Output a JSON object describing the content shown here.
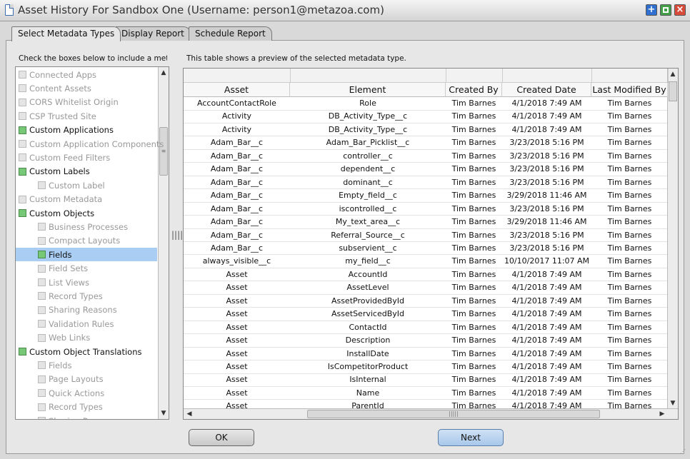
{
  "window": {
    "title": "Asset History For Sandbox One (Username: person1@metazoa.com)"
  },
  "tabs": [
    {
      "label": "Select Metadata Types",
      "active": true
    },
    {
      "label": "Display Report",
      "active": false
    },
    {
      "label": "Schedule Report",
      "active": false
    }
  ],
  "left_panel": {
    "instruction": "Check the boxes below to include a met",
    "items": [
      {
        "label": "Connected Apps",
        "indent": 0,
        "checked": false,
        "enabled": false,
        "selected": false
      },
      {
        "label": "Content Assets",
        "indent": 0,
        "checked": false,
        "enabled": false,
        "selected": false
      },
      {
        "label": "CORS Whitelist Origin",
        "indent": 0,
        "checked": false,
        "enabled": false,
        "selected": false
      },
      {
        "label": "CSP Trusted Site",
        "indent": 0,
        "checked": false,
        "enabled": false,
        "selected": false
      },
      {
        "label": "Custom Applications",
        "indent": 0,
        "checked": true,
        "enabled": true,
        "selected": false
      },
      {
        "label": "Custom Application Components",
        "indent": 0,
        "checked": false,
        "enabled": false,
        "selected": false
      },
      {
        "label": "Custom Feed Filters",
        "indent": 0,
        "checked": false,
        "enabled": false,
        "selected": false
      },
      {
        "label": "Custom Labels",
        "indent": 0,
        "checked": true,
        "enabled": true,
        "selected": false
      },
      {
        "label": "Custom Label",
        "indent": 1,
        "checked": false,
        "enabled": false,
        "selected": false
      },
      {
        "label": "Custom Metadata",
        "indent": 0,
        "checked": false,
        "enabled": false,
        "selected": false
      },
      {
        "label": "Custom Objects",
        "indent": 0,
        "checked": true,
        "enabled": true,
        "selected": false
      },
      {
        "label": "Business Processes",
        "indent": 1,
        "checked": false,
        "enabled": false,
        "selected": false
      },
      {
        "label": "Compact Layouts",
        "indent": 1,
        "checked": false,
        "enabled": false,
        "selected": false
      },
      {
        "label": "Fields",
        "indent": 1,
        "checked": true,
        "enabled": true,
        "selected": true
      },
      {
        "label": "Field Sets",
        "indent": 1,
        "checked": false,
        "enabled": false,
        "selected": false
      },
      {
        "label": "List Views",
        "indent": 1,
        "checked": false,
        "enabled": false,
        "selected": false
      },
      {
        "label": "Record Types",
        "indent": 1,
        "checked": false,
        "enabled": false,
        "selected": false
      },
      {
        "label": "Sharing Reasons",
        "indent": 1,
        "checked": false,
        "enabled": false,
        "selected": false
      },
      {
        "label": "Validation Rules",
        "indent": 1,
        "checked": false,
        "enabled": false,
        "selected": false
      },
      {
        "label": "Web Links",
        "indent": 1,
        "checked": false,
        "enabled": false,
        "selected": false
      },
      {
        "label": "Custom Object Translations",
        "indent": 0,
        "checked": true,
        "enabled": true,
        "selected": false
      },
      {
        "label": "Fields",
        "indent": 1,
        "checked": false,
        "enabled": false,
        "selected": false
      },
      {
        "label": "Page Layouts",
        "indent": 1,
        "checked": false,
        "enabled": false,
        "selected": false
      },
      {
        "label": "Quick Actions",
        "indent": 1,
        "checked": false,
        "enabled": false,
        "selected": false
      },
      {
        "label": "Record Types",
        "indent": 1,
        "checked": false,
        "enabled": false,
        "selected": false
      },
      {
        "label": "Sharing Reasons",
        "indent": 1,
        "checked": false,
        "enabled": false,
        "selected": false
      }
    ]
  },
  "right_panel": {
    "description": "This table shows a preview of the selected metadata type.",
    "columns": [
      "Asset",
      "Element",
      "Created By",
      "Created Date",
      "Last Modified By"
    ],
    "rows": [
      [
        "AccountContactRole",
        "Role",
        "Tim Barnes",
        "4/1/2018 7:49 AM",
        "Tim Barnes"
      ],
      [
        "Activity",
        "DB_Activity_Type__c",
        "Tim Barnes",
        "4/1/2018 7:49 AM",
        "Tim Barnes"
      ],
      [
        "Activity",
        "DB_Activity_Type__c",
        "Tim Barnes",
        "4/1/2018 7:49 AM",
        "Tim Barnes"
      ],
      [
        "Adam_Bar__c",
        "Adam_Bar_Picklist__c",
        "Tim Barnes",
        "3/23/2018 5:16 PM",
        "Tim Barnes"
      ],
      [
        "Adam_Bar__c",
        "controller__c",
        "Tim Barnes",
        "3/23/2018 5:16 PM",
        "Tim Barnes"
      ],
      [
        "Adam_Bar__c",
        "dependent__c",
        "Tim Barnes",
        "3/23/2018 5:16 PM",
        "Tim Barnes"
      ],
      [
        "Adam_Bar__c",
        "dominant__c",
        "Tim Barnes",
        "3/23/2018 5:16 PM",
        "Tim Barnes"
      ],
      [
        "Adam_Bar__c",
        "Empty_field__c",
        "Tim Barnes",
        "3/29/2018 11:46 AM",
        "Tim Barnes"
      ],
      [
        "Adam_Bar__c",
        "iscontrolled__c",
        "Tim Barnes",
        "3/23/2018 5:16 PM",
        "Tim Barnes"
      ],
      [
        "Adam_Bar__c",
        "My_text_area__c",
        "Tim Barnes",
        "3/29/2018 11:46 AM",
        "Tim Barnes"
      ],
      [
        "Adam_Bar__c",
        "Referral_Source__c",
        "Tim Barnes",
        "3/23/2018 5:16 PM",
        "Tim Barnes"
      ],
      [
        "Adam_Bar__c",
        "subservient__c",
        "Tim Barnes",
        "3/23/2018 5:16 PM",
        "Tim Barnes"
      ],
      [
        "always_visible__c",
        "my_field__c",
        "Tim Barnes",
        "10/10/2017 11:07 AM",
        "Tim Barnes"
      ],
      [
        "Asset",
        "AccountId",
        "Tim Barnes",
        "4/1/2018 7:49 AM",
        "Tim Barnes"
      ],
      [
        "Asset",
        "AssetLevel",
        "Tim Barnes",
        "4/1/2018 7:49 AM",
        "Tim Barnes"
      ],
      [
        "Asset",
        "AssetProvidedById",
        "Tim Barnes",
        "4/1/2018 7:49 AM",
        "Tim Barnes"
      ],
      [
        "Asset",
        "AssetServicedById",
        "Tim Barnes",
        "4/1/2018 7:49 AM",
        "Tim Barnes"
      ],
      [
        "Asset",
        "ContactId",
        "Tim Barnes",
        "4/1/2018 7:49 AM",
        "Tim Barnes"
      ],
      [
        "Asset",
        "Description",
        "Tim Barnes",
        "4/1/2018 7:49 AM",
        "Tim Barnes"
      ],
      [
        "Asset",
        "InstallDate",
        "Tim Barnes",
        "4/1/2018 7:49 AM",
        "Tim Barnes"
      ],
      [
        "Asset",
        "IsCompetitorProduct",
        "Tim Barnes",
        "4/1/2018 7:49 AM",
        "Tim Barnes"
      ],
      [
        "Asset",
        "IsInternal",
        "Tim Barnes",
        "4/1/2018 7:49 AM",
        "Tim Barnes"
      ],
      [
        "Asset",
        "Name",
        "Tim Barnes",
        "4/1/2018 7:49 AM",
        "Tim Barnes"
      ],
      [
        "Asset",
        "ParentId",
        "Tim Barnes",
        "4/1/2018 7:49 AM",
        "Tim Barnes"
      ]
    ]
  },
  "buttons": {
    "ok": "OK",
    "next": "Next"
  }
}
